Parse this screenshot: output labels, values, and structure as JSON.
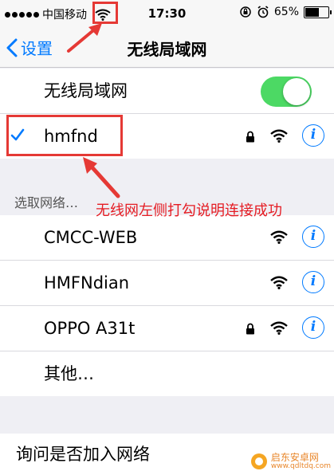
{
  "status_bar": {
    "carrier": "中国移动",
    "time": "17:30",
    "battery": "65%",
    "battery_level": 0.65
  },
  "nav": {
    "back_label": "设置",
    "title": "无线局域网"
  },
  "wifi_toggle": {
    "label": "无线局域网",
    "on": true
  },
  "connected": {
    "name": "hmfnd"
  },
  "section": {
    "header": "选取网络…"
  },
  "annotation": {
    "text": "无线网左侧打勾说明连接成功"
  },
  "networks": [
    {
      "name": "CMCC-WEB",
      "locked": false
    },
    {
      "name": "HMFNdian",
      "locked": false
    },
    {
      "name": "OPPO A31t",
      "locked": true
    }
  ],
  "other": {
    "label": "其他…"
  },
  "ask_join": {
    "label": "询问是否加入网络"
  },
  "watermark": {
    "text": "启东安卓网",
    "url": "www.qdltdq.com"
  },
  "colors": {
    "accent": "#007aff",
    "toggle_on": "#4cd964",
    "annotation": "#e53935"
  }
}
